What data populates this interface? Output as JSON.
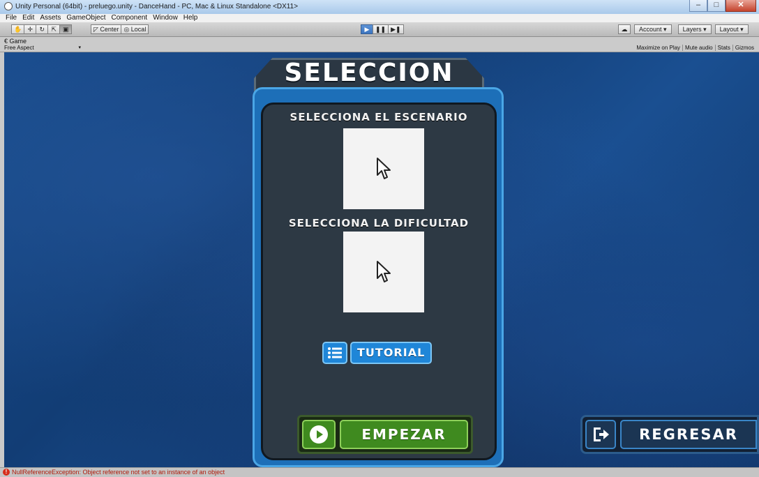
{
  "window": {
    "title": "Unity Personal (64bit) - preluego.unity - DanceHand - PC, Mac & Linux Standalone <DX11>",
    "controls": [
      "–",
      "□",
      "✕"
    ]
  },
  "menubar": [
    "File",
    "Edit",
    "Assets",
    "GameObject",
    "Component",
    "Window",
    "Help"
  ],
  "toolbar": {
    "pivot": "Center",
    "space": "Local",
    "account": "Account",
    "layers": "Layers",
    "layout": "Layout",
    "play_active": true
  },
  "game_view": {
    "tab": "Game",
    "aspect": "Free Aspect",
    "options": [
      "Maximize on Play",
      "Mute audio",
      "Stats",
      "Gizmos"
    ]
  },
  "game": {
    "title": "SELECCION",
    "scene_label": "SELECCIONA EL ESCENARIO",
    "difficulty_label": "SELECCIONA LA DIFICULTAD",
    "tutorial": "TUTORIAL",
    "start": "EMPEZAR",
    "back": "REGRESAR"
  },
  "status": {
    "message": "NullReferenceException: Object reference not set to an instance of an object"
  },
  "colors": {
    "background": "#174a8a",
    "panel": "#2d3944",
    "panel_border": "#1d6fb8",
    "start_green": "#3f8a1f",
    "tutorial_blue": "#1f86d8",
    "back_navy": "#1b3553",
    "error_red": "#d62c1a"
  }
}
